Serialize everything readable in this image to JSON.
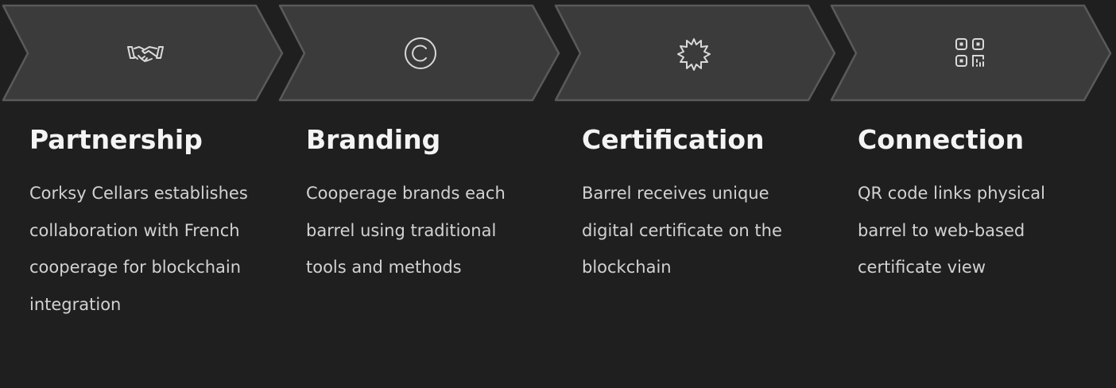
{
  "steps": [
    {
      "icon": "handshake-icon",
      "title": "Partnership",
      "description": "Corksy Cellars establishes collaboration with French cooperage for blockchain integration"
    },
    {
      "icon": "copyright-icon",
      "title": "Branding",
      "description": "Cooperage brands each barrel using traditional tools and methods"
    },
    {
      "icon": "badge-seal-icon",
      "title": "Certification",
      "description": "Barrel receives unique digital certificate on the blockchain"
    },
    {
      "icon": "qr-code-icon",
      "title": "Connection",
      "description": "QR code links physical barrel to web-based certificate view"
    }
  ],
  "colors": {
    "background": "#1f1f1f",
    "chevron_fill": "#3b3b3b",
    "chevron_stroke": "#5a5a5a",
    "icon": "#d9d9d9",
    "title": "#f4f4f4",
    "text": "#d2d2d2"
  }
}
